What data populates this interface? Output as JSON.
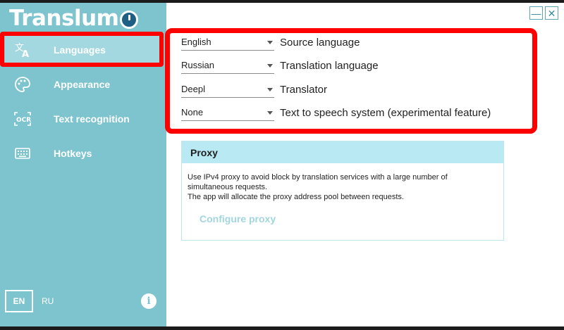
{
  "app": {
    "name": "Translum"
  },
  "sidebar": {
    "items": [
      {
        "label": "Languages",
        "icon": "translate-icon",
        "active": true
      },
      {
        "label": "Appearance",
        "icon": "palette-icon"
      },
      {
        "label": "Text recognition",
        "icon": "ocr-icon"
      },
      {
        "label": "Hotkeys",
        "icon": "keyboard-icon"
      }
    ],
    "language_buttons": {
      "en": "EN",
      "ru": "RU"
    },
    "info_glyph": "i"
  },
  "window_controls": {
    "minimize": "—",
    "close": "✕"
  },
  "settings": [
    {
      "value": "English",
      "label": "Source language"
    },
    {
      "value": "Russian",
      "label": "Translation language"
    },
    {
      "value": "Deepl",
      "label": "Translator"
    },
    {
      "value": "None",
      "label": "Text to speech system (experimental feature)"
    }
  ],
  "proxy": {
    "title": "Proxy",
    "description": "Use IPv4 proxy to avoid block by translation services with a large number of\nsimultaneous requests.\nThe app will allocate the proxy address pool between requests.",
    "link": "Configure proxy"
  },
  "colors": {
    "sidebar": "#7ec4cf",
    "sidebar_active": "#a4d8e0",
    "highlight": "#ff0000",
    "proxy_header": "#b9eaf3",
    "logo_accent": "#1f5f83"
  }
}
